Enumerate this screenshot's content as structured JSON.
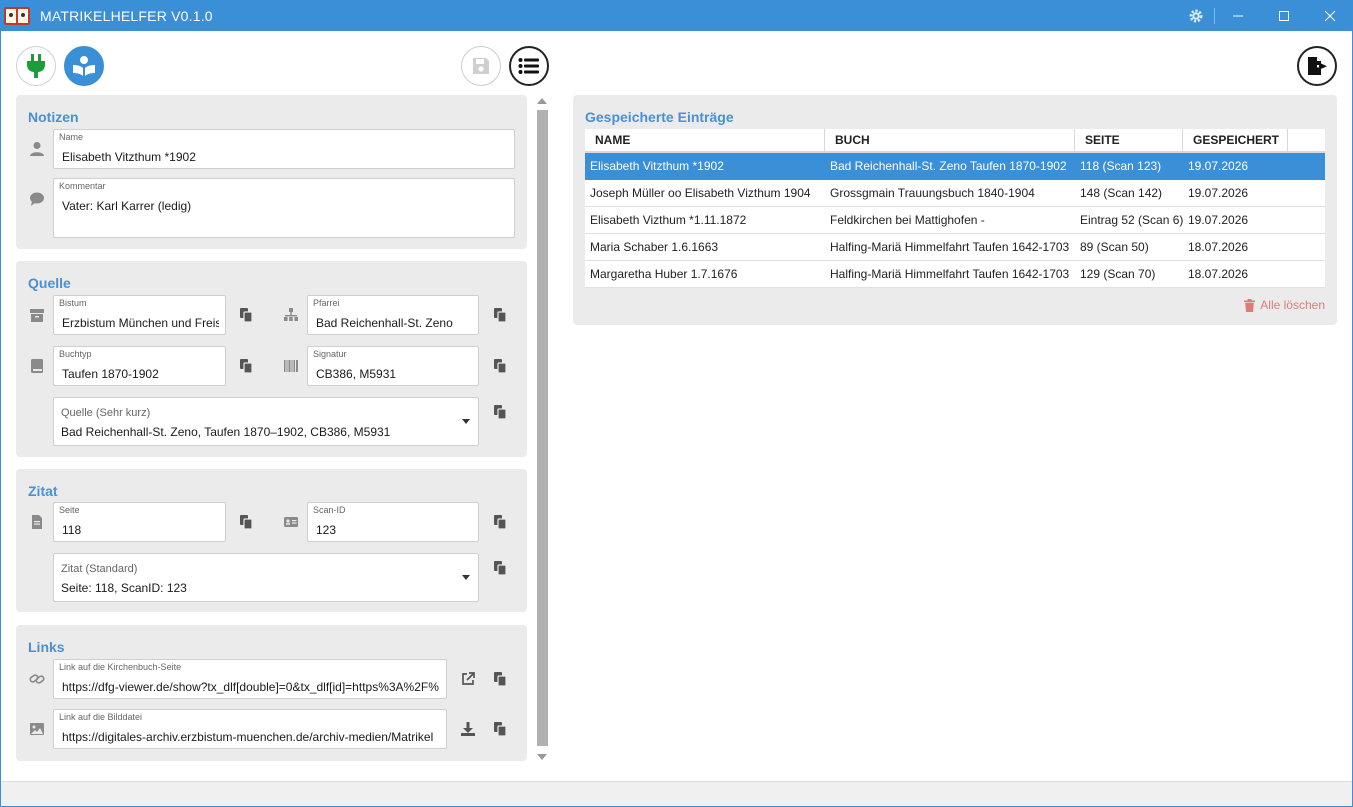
{
  "window": {
    "title": "MATRIKELHELFER V0.1.0",
    "accent": "#3a8fd6"
  },
  "toolbar": {
    "connect_icon": "plug-icon",
    "reader_icon": "book-reader-icon",
    "save_icon": "save-icon",
    "list_icon": "list-icon",
    "export_icon": "file-export-icon"
  },
  "notizen": {
    "title": "Notizen",
    "name_label": "Name",
    "name_value": "Elisabeth Vitzthum *1902",
    "kommentar_label": "Kommentar",
    "kommentar_value": "Vater: Karl Karrer (ledig)"
  },
  "quelle": {
    "title": "Quelle",
    "bistum_label": "Bistum",
    "bistum_value": "Erzbistum München und Freis",
    "pfarrei_label": "Pfarrei",
    "pfarrei_value": "Bad Reichenhall-St. Zeno",
    "buchtyp_label": "Buchtyp",
    "buchtyp_value": "Taufen 1870-1902",
    "signatur_label": "Signatur",
    "signatur_value": "CB386, M5931",
    "kurz_label": "Quelle (Sehr kurz)",
    "kurz_value": "Bad Reichenhall-St. Zeno, Taufen 1870–1902, CB386, M5931"
  },
  "zitat": {
    "title": "Zitat",
    "seite_label": "Seite",
    "seite_value": "118",
    "scan_label": "Scan-ID",
    "scan_value": "123",
    "zitat_label": "Zitat (Standard)",
    "zitat_value": "Seite: 118, ScanID: 123"
  },
  "links": {
    "title": "Links",
    "kirchenbuch_label": "Link auf die Kirchenbuch-Seite",
    "kirchenbuch_value": "https://dfg-viewer.de/show?tx_dlf[double]=0&tx_dlf[id]=https%3A%2F%",
    "bild_label": "Link auf die Bilddatei",
    "bild_value": "https://digitales-archiv.erzbistum-muenchen.de/archiv-medien/Matrikel"
  },
  "saved": {
    "title": "Gespeicherte Einträge",
    "columns": [
      "NAME",
      "BUCH",
      "SEITE",
      "GESPEICHERT"
    ],
    "rows": [
      {
        "name": "Elisabeth Vitzthum *1902",
        "buch": "Bad Reichenhall-St. Zeno Taufen 1870-1902",
        "seite": "118 (Scan 123)",
        "gespeichert": "19.07.2026"
      },
      {
        "name": "Joseph Müller oo Elisabeth Vizthum 1904",
        "buch": "Grossgmain Trauungsbuch 1840-1904",
        "seite": "148 (Scan 142)",
        "gespeichert": "19.07.2026"
      },
      {
        "name": "Elisabeth Vizthum *1.11.1872",
        "buch": "Feldkirchen bei Mattighofen  -",
        "seite": "Eintrag 52 (Scan 6)",
        "gespeichert": "19.07.2026"
      },
      {
        "name": "Maria Schaber 1.6.1663",
        "buch": "Halfing-Mariä Himmelfahrt Taufen 1642-1703",
        "seite": "89 (Scan 50)",
        "gespeichert": "18.07.2026"
      },
      {
        "name": "Margaretha Huber 1.7.1676",
        "buch": "Halfing-Mariä Himmelfahrt Taufen 1642-1703",
        "seite": "129 (Scan 70)",
        "gespeichert": "18.07.2026"
      }
    ],
    "delete_all": "Alle löschen"
  }
}
